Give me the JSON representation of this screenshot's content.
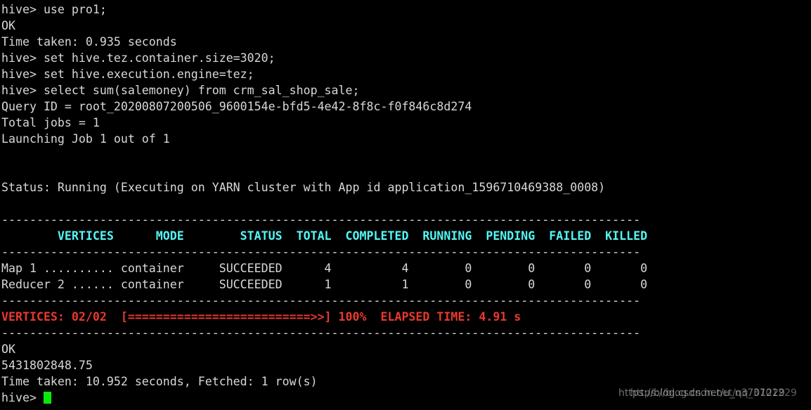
{
  "terminal": {
    "prompt": "hive> ",
    "lines": [
      {
        "id": "cmd-use-db",
        "type": "text",
        "class": "c-white",
        "text": "hive> use pro1;"
      },
      {
        "id": "status-ok-1",
        "type": "text",
        "class": "c-white",
        "text": "OK"
      },
      {
        "id": "time-taken-1",
        "type": "text",
        "class": "c-white",
        "text": "Time taken: 0.935 seconds"
      },
      {
        "id": "cmd-set-container",
        "type": "text",
        "class": "c-white",
        "text": "hive> set hive.tez.container.size=3020;"
      },
      {
        "id": "cmd-set-engine",
        "type": "text",
        "class": "c-white",
        "text": "hive> set hive.execution.engine=tez;"
      },
      {
        "id": "cmd-select-sum",
        "type": "text",
        "class": "c-white",
        "text": "hive> select sum(salemoney) from crm_sal_shop_sale;"
      },
      {
        "id": "query-id",
        "type": "text",
        "class": "c-white",
        "text": "Query ID = root_20200807200506_9600154e-bfd5-4e42-8f8c-f0f846c8d274"
      },
      {
        "id": "total-jobs",
        "type": "text",
        "class": "c-white",
        "text": "Total jobs = 1"
      },
      {
        "id": "launching-job",
        "type": "text",
        "class": "c-white",
        "text": "Launching Job 1 out of 1"
      },
      {
        "id": "blank-1",
        "type": "blank",
        "class": "blank",
        "text": " "
      },
      {
        "id": "blank-2",
        "type": "blank",
        "class": "blank",
        "text": " "
      },
      {
        "id": "status-running",
        "type": "text",
        "class": "c-white",
        "text": "Status: Running (Executing on YARN cluster with App id application_1596710469388_0008)"
      },
      {
        "id": "blank-3",
        "type": "blank",
        "class": "blank",
        "text": " "
      },
      {
        "id": "separator-top",
        "type": "text",
        "class": "c-sep",
        "text": "-------------------------------------------------------------------------------------------"
      },
      {
        "id": "vertices-header",
        "type": "text",
        "class": "c-cyan",
        "text": "        VERTICES      MODE        STATUS  TOTAL  COMPLETED  RUNNING  PENDING  FAILED  KILLED"
      },
      {
        "id": "separator-mid",
        "type": "text",
        "class": "c-sep",
        "text": "-------------------------------------------------------------------------------------------"
      },
      {
        "id": "vertex-row-map1",
        "type": "text",
        "class": "c-white",
        "text": "Map 1 .......... container     SUCCEEDED      4          4        0        0       0       0"
      },
      {
        "id": "vertex-row-reducer2",
        "type": "text",
        "class": "c-white",
        "text": "Reducer 2 ...... container     SUCCEEDED      1          1        0        0       0       0"
      },
      {
        "id": "separator-progress-top",
        "type": "text",
        "class": "c-sep",
        "text": "-------------------------------------------------------------------------------------------"
      },
      {
        "id": "progress-bar",
        "type": "text",
        "class": "c-red",
        "text": "VERTICES: 02/02  [==========================>>] 100%  ELAPSED TIME: 4.91 s"
      },
      {
        "id": "separator-bottom",
        "type": "text",
        "class": "c-sep",
        "text": "-------------------------------------------------------------------------------------------"
      },
      {
        "id": "status-ok-2",
        "type": "text",
        "class": "c-white",
        "text": "OK"
      },
      {
        "id": "query-result-value",
        "type": "text",
        "class": "c-white",
        "text": "5431802848.75"
      },
      {
        "id": "time-taken-2",
        "type": "text",
        "class": "c-white",
        "text": "Time taken: 10.952 seconds, Fetched: 1 row(s)"
      }
    ],
    "final_prompt": "hive> "
  },
  "vertices_table": {
    "columns": [
      "VERTICES",
      "MODE",
      "STATUS",
      "TOTAL",
      "COMPLETED",
      "RUNNING",
      "PENDING",
      "FAILED",
      "KILLED"
    ],
    "rows": [
      {
        "vertex": "Map 1",
        "dots": "..........",
        "mode": "container",
        "status": "SUCCEEDED",
        "total": "4",
        "completed": "4",
        "running": "0",
        "pending": "0",
        "failed": "0",
        "killed": "0"
      },
      {
        "vertex": "Reducer 2",
        "dots": "......",
        "mode": "container",
        "status": "SUCCEEDED",
        "total": "1",
        "completed": "1",
        "running": "0",
        "pending": "0",
        "failed": "0",
        "killed": "0"
      }
    ],
    "summary": {
      "vertices_done": "02/02",
      "bar": "[==========================>>]",
      "percent": "100%",
      "elapsed_label": "ELAPSED TIME:",
      "elapsed_value": "4.91 s"
    }
  },
  "colors": {
    "background": "#000000",
    "foreground": "#d8d8d8",
    "header_cyan": "#54f6f6",
    "progress_red": "#e8392e",
    "cursor_green": "#0ae80a"
  },
  "watermark": {
    "line_a": "https://blog.csdn.net/u_n3701229",
    "line_b": "https://blog.csdn.net/qq_3701229"
  }
}
